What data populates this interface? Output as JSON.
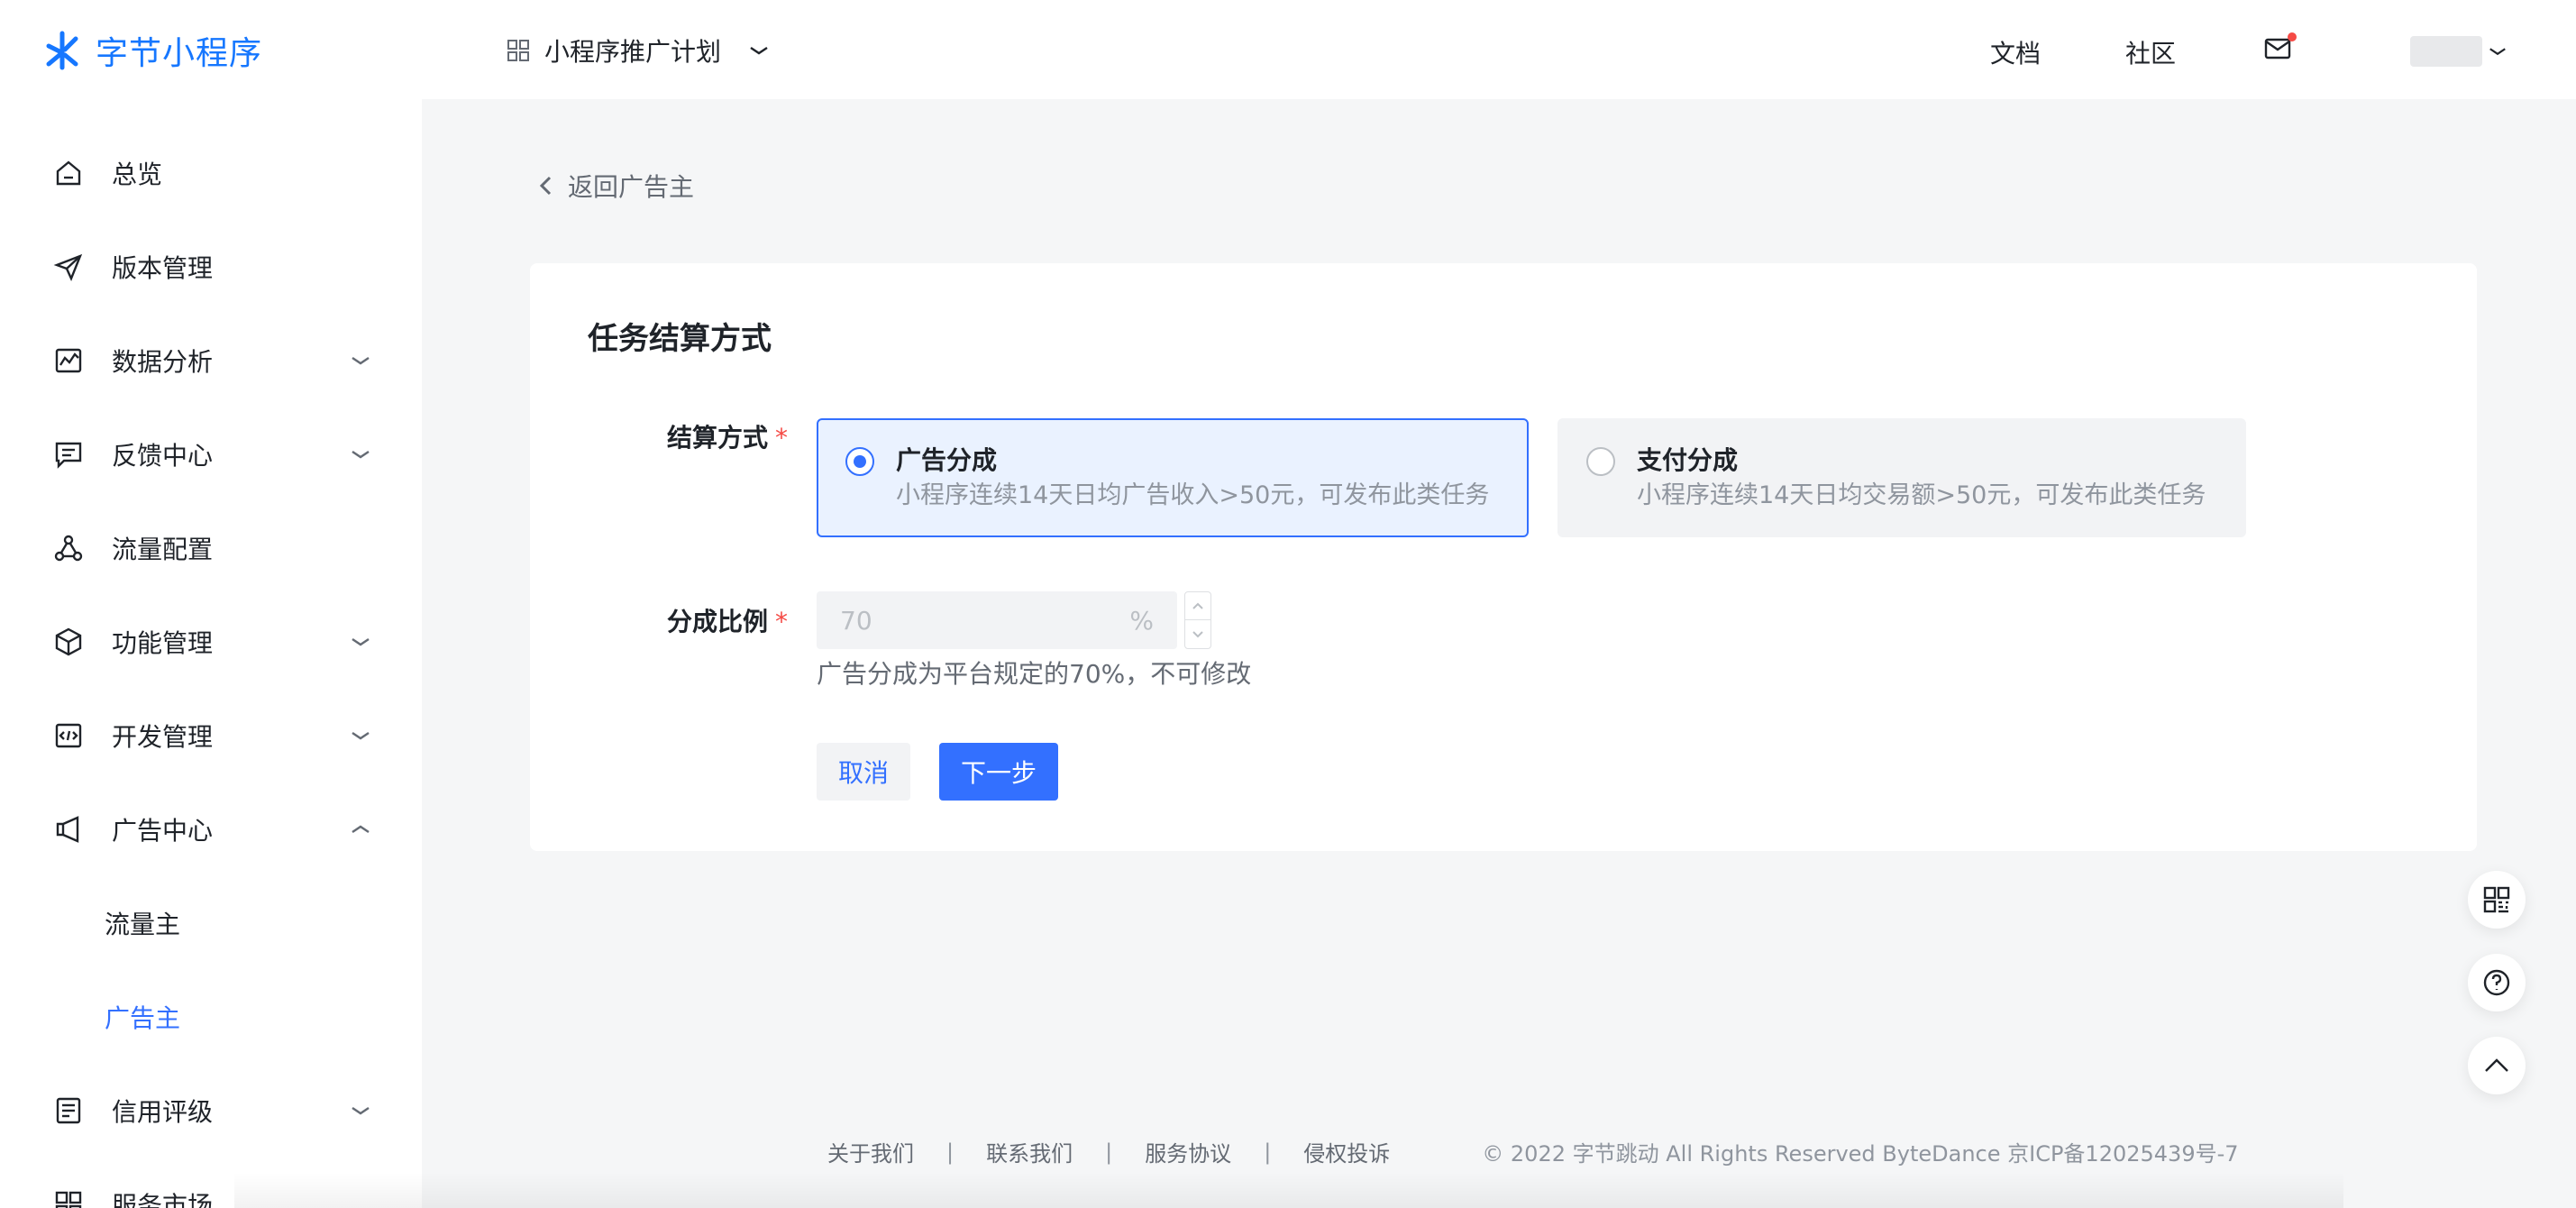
{
  "app": {
    "logo_text": "字节小程序",
    "brand_color": "#1677ff"
  },
  "sidebar": {
    "items": [
      {
        "label": "总览",
        "icon": "home-icon"
      },
      {
        "label": "版本管理",
        "icon": "send-icon"
      },
      {
        "label": "数据分析",
        "icon": "chart-icon",
        "expandable": true
      },
      {
        "label": "反馈中心",
        "icon": "message-icon",
        "expandable": true
      },
      {
        "label": "流量配置",
        "icon": "share-icon"
      },
      {
        "label": "功能管理",
        "icon": "cube-icon",
        "expandable": true
      },
      {
        "label": "开发管理",
        "icon": "code-icon",
        "expandable": true
      },
      {
        "label": "广告中心",
        "icon": "megaphone-icon",
        "expandable": true,
        "expanded": true
      },
      {
        "label": "信用评级",
        "icon": "document-icon",
        "expandable": true
      },
      {
        "label": "服务市场",
        "icon": "grid-icon"
      }
    ],
    "ad_center_children": [
      {
        "label": "流量主",
        "active": false
      },
      {
        "label": "广告主",
        "active": true
      }
    ],
    "active_color": "#3370ff"
  },
  "header": {
    "project_label": "小程序推广计划",
    "docs_label": "文档",
    "community_label": "社区"
  },
  "back_link": {
    "label": "返回广告主"
  },
  "form": {
    "title": "任务结算方式",
    "settlement_label": "结算方式",
    "required_mark": "*",
    "options": [
      {
        "title": "广告分成",
        "desc": "小程序连续14天日均广告收入>50元，可发布此类任务",
        "selected": true
      },
      {
        "title": "支付分成",
        "desc": "小程序连续14天日均交易额>50元，可发布此类任务",
        "selected": false
      }
    ],
    "ratio_label": "分成比例",
    "ratio_value": "70",
    "ratio_unit": "%",
    "ratio_hint": "广告分成为平台规定的70%，不可修改",
    "cancel_label": "取消",
    "next_label": "下一步"
  },
  "float_tools": [
    "qr-code-icon",
    "help-icon",
    "back-to-top-icon"
  ],
  "footer": {
    "links": [
      "关于我们",
      "联系我们",
      "服务协议",
      "侵权投诉"
    ],
    "copyright": "© 2022 字节跳动 All Rights Reserved ByteDance 京ICP备12025439号-7"
  }
}
